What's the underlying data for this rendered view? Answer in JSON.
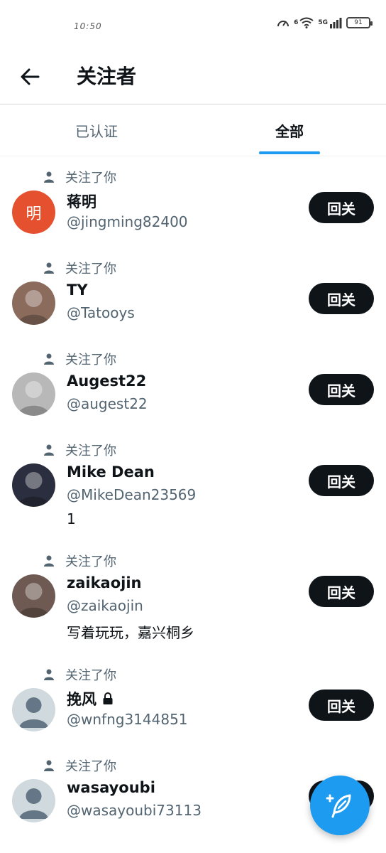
{
  "status_bar": {
    "time": "10:50",
    "signal_label": "5G",
    "wifi_label": "6",
    "battery": "91"
  },
  "header": {
    "title": "关注者",
    "back_icon": "arrow-left-icon"
  },
  "tabs": [
    {
      "label": "已认证",
      "active": false
    },
    {
      "label": "全部",
      "active": true
    }
  ],
  "followers": [
    {
      "follows_you": "关注了你",
      "name": "蒋明",
      "handle": "@jingming82400",
      "bio": "",
      "avatar_text": "明",
      "avatar_color": "#e5512f",
      "locked": false,
      "button": "回关"
    },
    {
      "follows_you": "关注了你",
      "name": "TY",
      "handle": "@Tatooys",
      "bio": "",
      "avatar_text": "",
      "avatar_color": "#8a6b5c",
      "locked": false,
      "button": "回关"
    },
    {
      "follows_you": "关注了你",
      "name": "Augest22",
      "handle": "@augest22",
      "bio": "",
      "avatar_text": "",
      "avatar_color": "#b8b8b8",
      "locked": false,
      "button": "回关"
    },
    {
      "follows_you": "关注了你",
      "name": "Mike Dean",
      "handle": "@MikeDean23569",
      "bio": "1",
      "avatar_text": "",
      "avatar_color": "#2b2e3e",
      "locked": false,
      "button": "回关"
    },
    {
      "follows_you": "关注了你",
      "name": "zaikaojin",
      "handle": "@zaikaojin",
      "bio": "写着玩玩，嘉兴桐乡",
      "avatar_text": "",
      "avatar_color": "#6e5a52",
      "locked": false,
      "button": "回关"
    },
    {
      "follows_you": "关注了你",
      "name": "挽风",
      "handle": "@wnfng3144851",
      "bio": "",
      "avatar_text": "",
      "avatar_color": "#cfd9de",
      "locked": true,
      "button": "回关"
    },
    {
      "follows_you": "关注了你",
      "name": "wasayoubi",
      "handle": "@wasayoubi73113",
      "bio": "",
      "avatar_text": "",
      "avatar_color": "#cfd9de",
      "locked": false,
      "button": "回关"
    }
  ],
  "fab": {
    "icon": "compose-feather-icon"
  },
  "colors": {
    "accent": "#1d9bf0",
    "button_bg": "#0f1419",
    "secondary_text": "#536471"
  }
}
